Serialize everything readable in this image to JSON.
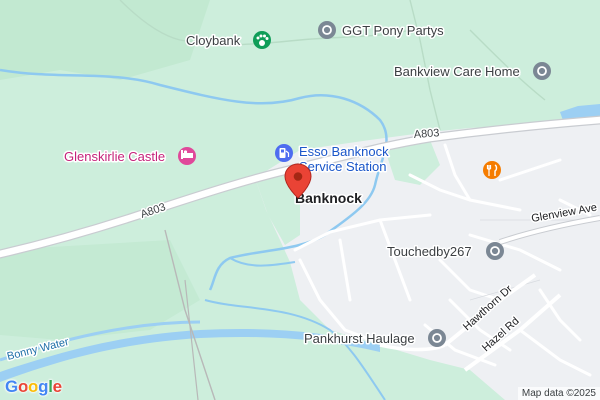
{
  "map": {
    "town": "Banknock",
    "roads": {
      "main_route_a": "A803",
      "main_route_b": "A803",
      "glenview": "Glenview Ave",
      "hawthorn": "Hawthorn Dr",
      "hazel": "Hazel Rd"
    },
    "water": {
      "river": "Bonny Water"
    },
    "pois": [
      {
        "id": "cloybank",
        "name": "Cloybank",
        "icon": "paw-icon",
        "color": "#0f9d58"
      },
      {
        "id": "ggt",
        "name": "GGT Pony Partys",
        "icon": "place-icon",
        "color": "#7b8794"
      },
      {
        "id": "bankview",
        "name": "Bankview Care Home",
        "icon": "place-icon",
        "color": "#7b8794"
      },
      {
        "id": "glenskirlie",
        "name": "Glenskirlie Castle",
        "icon": "hotel-icon",
        "color": "#e0489a"
      },
      {
        "id": "esso",
        "name": "Esso Banknock Service Station",
        "name_line1": "Esso Banknock",
        "name_line2": "Service Station",
        "icon": "fuel-icon",
        "color": "#4e6cf0"
      },
      {
        "id": "restaurant",
        "name": "",
        "icon": "restaurant-icon",
        "color": "#f57c00"
      },
      {
        "id": "touchedby",
        "name": "Touchedby267",
        "icon": "place-icon",
        "color": "#7b8794"
      },
      {
        "id": "pankhurst",
        "name": "Pankhurst Haulage",
        "icon": "place-icon",
        "color": "#7b8794"
      }
    ],
    "marker": {
      "icon": "red-pin-icon",
      "color": "#ea4335"
    }
  },
  "branding": {
    "logo_letters": [
      "G",
      "o",
      "o",
      "g",
      "l",
      "e"
    ],
    "logo_colors": [
      "#4285f4",
      "#ea4335",
      "#fbbc05",
      "#4285f4",
      "#34a853",
      "#ea4335"
    ]
  },
  "attribution": "Map data ©2025",
  "colors": {
    "land": "#cdeedc",
    "urban": "#eef0f3",
    "road": "#ffffff",
    "road_casing": "#c9ccd1",
    "water": "#9ccff3",
    "stream": "#8ec9f0"
  }
}
